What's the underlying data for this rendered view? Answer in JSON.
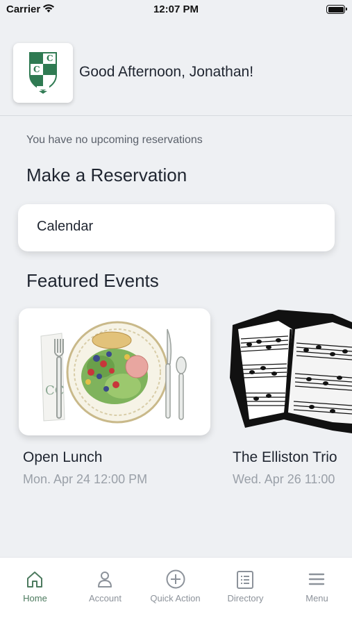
{
  "status_bar": {
    "carrier": "Carrier",
    "time": "12:07 PM"
  },
  "header": {
    "greeting": "Good Afternoon, Jonathan!",
    "logo_icon": "club-crest-logo"
  },
  "reservations": {
    "empty_message": "You have no upcoming reservations"
  },
  "make_reservation": {
    "title": "Make a Reservation",
    "calendar_label": "Calendar"
  },
  "featured": {
    "title": "Featured Events",
    "events": [
      {
        "name": "Open Lunch",
        "date": "Mon. Apr 24 12:00 PM",
        "image_icon": "plate-illustration"
      },
      {
        "name": "The Elliston Trio",
        "date": "Wed. Apr 26 11:00",
        "image_icon": "sheet-music-illustration"
      }
    ]
  },
  "tab_bar": {
    "items": [
      {
        "label": "Home",
        "icon": "home-icon",
        "active": true
      },
      {
        "label": "Account",
        "icon": "person-icon",
        "active": false
      },
      {
        "label": "Quick Action",
        "icon": "plus-circle-icon",
        "active": false
      },
      {
        "label": "Directory",
        "icon": "list-icon",
        "active": false
      },
      {
        "label": "Menu",
        "icon": "hamburger-icon",
        "active": false
      }
    ]
  },
  "colors": {
    "accent": "#4c7a5e",
    "background": "#eef0f3",
    "crest_green": "#2f7a52"
  }
}
